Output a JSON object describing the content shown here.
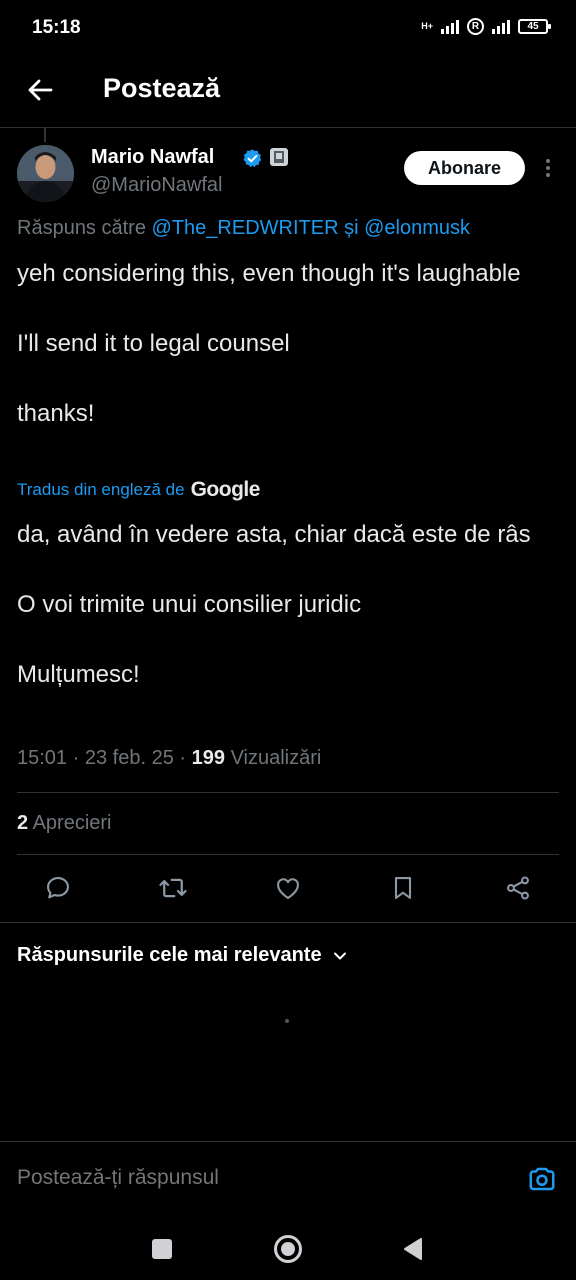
{
  "status_bar": {
    "time": "15:18",
    "network_label": "H+",
    "roaming_label": "R",
    "battery": "45"
  },
  "header": {
    "title": "Postează"
  },
  "post": {
    "author_name": "Mario Nawfal",
    "author_handle": "@MarioNawfal",
    "follow_label": "Abonare",
    "reply_prefix": "Răspuns către",
    "reply_mention_1": "@The_REDWRITER",
    "reply_conjunction": "și",
    "reply_mention_2": "@elonmusk",
    "text": [
      "yeh considering this, even though it's laughable",
      "I'll send it to legal counsel",
      "thanks!"
    ],
    "translated_label": "Tradus din engleză de",
    "translator_logo": "Google",
    "translation": [
      "da, având în vedere asta, chiar dacă este de râs",
      "O voi trimite unui consilier juridic",
      "Mulțumesc!"
    ],
    "time": "15:01",
    "date": "23 feb. 25",
    "separator": "·",
    "views_count": "199",
    "views_label": "Vizualizări",
    "likes_count": "2",
    "likes_label": "Aprecieri"
  },
  "actions": [
    "reply-icon",
    "repost-icon",
    "like-icon",
    "bookmark-icon",
    "share-icon"
  ],
  "replies": {
    "sort_label": "Răspunsurile cele mai relevante"
  },
  "compose": {
    "placeholder": "Postează-ți răspunsul"
  },
  "colors": {
    "background": "#000000",
    "accent": "#1d9bf0",
    "secondary_text": "#71767b",
    "divider": "#2f3336"
  }
}
